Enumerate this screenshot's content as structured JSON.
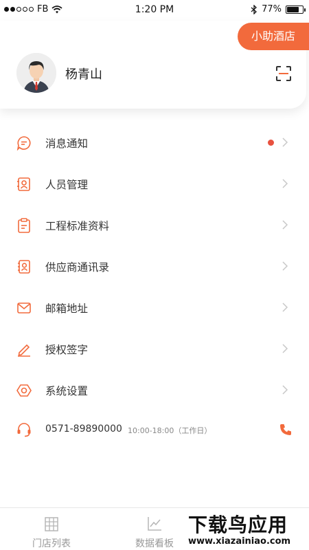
{
  "status_bar": {
    "carrier": "FB",
    "time": "1:20 PM",
    "battery_percent": "77%",
    "battery_level": 0.77,
    "signal_bars": 2
  },
  "header": {
    "badge_label": "小助酒店",
    "user_name": "杨青山"
  },
  "menu": {
    "items": [
      {
        "label": "消息通知",
        "icon": "message-icon",
        "has_unread": true
      },
      {
        "label": "人员管理",
        "icon": "personnel-icon"
      },
      {
        "label": "工程标准资料",
        "icon": "clipboard-icon"
      },
      {
        "label": "供应商通讯录",
        "icon": "contacts-icon"
      },
      {
        "label": "邮箱地址",
        "icon": "mail-icon"
      },
      {
        "label": "授权签字",
        "icon": "pen-icon"
      },
      {
        "label": "系统设置",
        "icon": "settings-icon"
      }
    ],
    "hotline": {
      "number": "0571-89890000",
      "hours": "10:00-18:00（工作日）"
    }
  },
  "tab_bar": {
    "tabs": [
      {
        "label": "门店列表",
        "icon": "building-icon"
      },
      {
        "label": "数据看板",
        "icon": "chart-icon"
      }
    ]
  },
  "watermark": {
    "title": "下载鸟应用",
    "url": "www.xiazainiao.com"
  },
  "colors": {
    "accent": "#f26a3c",
    "unread": "#e8513f",
    "text": "#333333",
    "muted": "#999999"
  }
}
